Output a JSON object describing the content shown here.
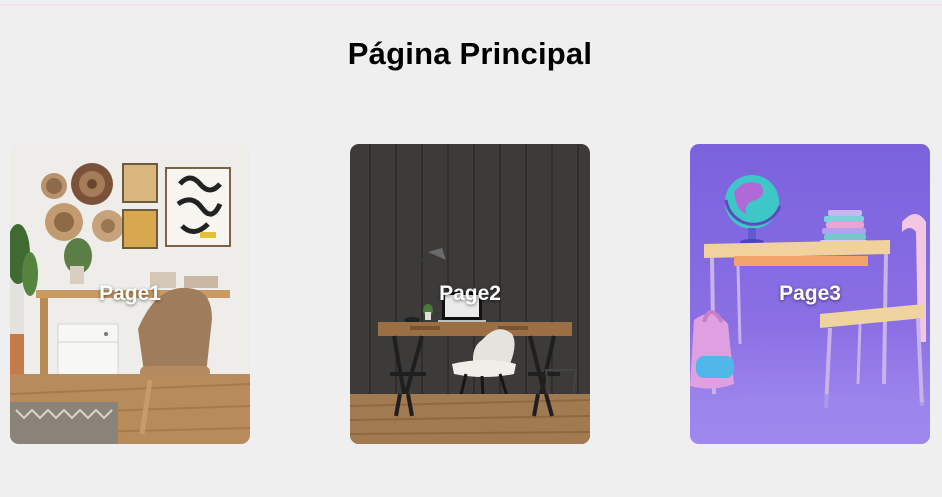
{
  "page": {
    "title": "Página Principal"
  },
  "cards": [
    {
      "label": "Page1"
    },
    {
      "label": "Page2"
    },
    {
      "label": "Page3"
    }
  ],
  "colors": {
    "background": "#f0eff0",
    "title": "#000000",
    "card_label": "#ffffff"
  }
}
